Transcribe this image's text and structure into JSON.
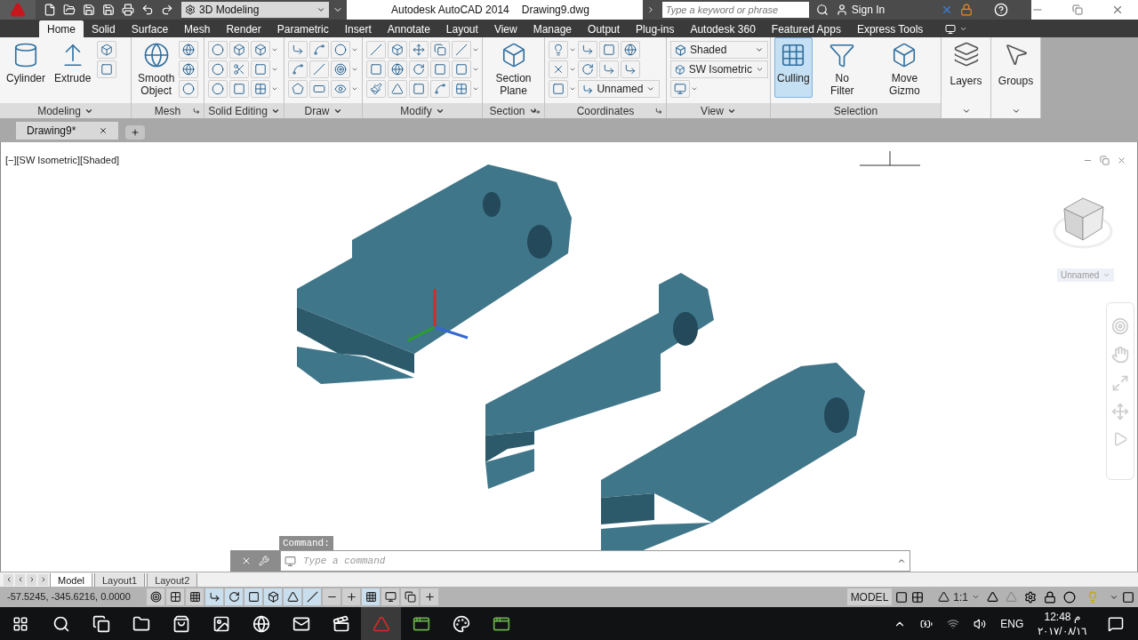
{
  "app": {
    "workspace": "3D Modeling",
    "title": "Autodesk AutoCAD 2014",
    "file": "Drawing9.dwg",
    "search_placeholder": "Type a keyword or phrase",
    "sign_in": "Sign In"
  },
  "ribbon_tabs": [
    {
      "label": "Home",
      "selected": true
    },
    {
      "label": "Solid",
      "selected": false
    },
    {
      "label": "Surface",
      "selected": false
    },
    {
      "label": "Mesh",
      "selected": false
    },
    {
      "label": "Render",
      "selected": false
    },
    {
      "label": "Parametric",
      "selected": false
    },
    {
      "label": "Insert",
      "selected": false
    },
    {
      "label": "Annotate",
      "selected": false
    },
    {
      "label": "Layout",
      "selected": false
    },
    {
      "label": "View",
      "selected": false
    },
    {
      "label": "Manage",
      "selected": false
    },
    {
      "label": "Output",
      "selected": false
    },
    {
      "label": "Plug-ins",
      "selected": false
    },
    {
      "label": "Autodesk 360",
      "selected": false
    },
    {
      "label": "Featured Apps",
      "selected": false
    },
    {
      "label": "Express Tools",
      "selected": false
    }
  ],
  "panels": [
    {
      "kind": "modeling",
      "title": "Modeling",
      "buttons": [
        "Cylinder",
        "Extrude"
      ]
    },
    {
      "kind": "mesh",
      "title": "Mesh",
      "buttons": [
        "Smooth Object"
      ]
    },
    {
      "kind": "solid_editing",
      "title": "Solid Editing"
    },
    {
      "kind": "draw",
      "title": "Draw"
    },
    {
      "kind": "modify",
      "title": "Modify"
    },
    {
      "kind": "section",
      "title": "Section",
      "buttons": [
        "Section Plane"
      ]
    },
    {
      "kind": "coordinates",
      "title": "Coordinates",
      "dropdowns": [
        "Unnamed"
      ]
    },
    {
      "kind": "view",
      "title": "View",
      "dropdowns": [
        "Shaded",
        "SW Isometric"
      ]
    },
    {
      "kind": "selection",
      "title": "Selection",
      "buttons": [
        {
          "label": "Culling",
          "on": true
        },
        {
          "label": "No Filter",
          "on": false
        },
        {
          "label": "Move Gizmo",
          "on": false
        }
      ]
    },
    {
      "kind": "collapsed",
      "label": "Layers"
    },
    {
      "kind": "collapsed",
      "label": "Groups"
    }
  ],
  "doc_tabs": [
    {
      "label": "Drawing9*",
      "selected": true
    }
  ],
  "viewport": {
    "controls": "[−][SW Isometric][Shaded]",
    "view_name": "Unnamed"
  },
  "command_line": {
    "history": "Command:",
    "placeholder": "Type a command"
  },
  "layout_tabs": [
    {
      "label": "Model",
      "selected": true
    },
    {
      "label": "Layout1",
      "selected": false
    },
    {
      "label": "Layout2",
      "selected": false
    }
  ],
  "status_bar": {
    "coordinates": "-57.5245, -345.6216, 0.0000",
    "space": "MODEL",
    "scale": "1:1"
  },
  "taskbar": {
    "language": "ENG",
    "time": "12:48 م",
    "date": "٢٠١٧/٠٨/١٦"
  }
}
